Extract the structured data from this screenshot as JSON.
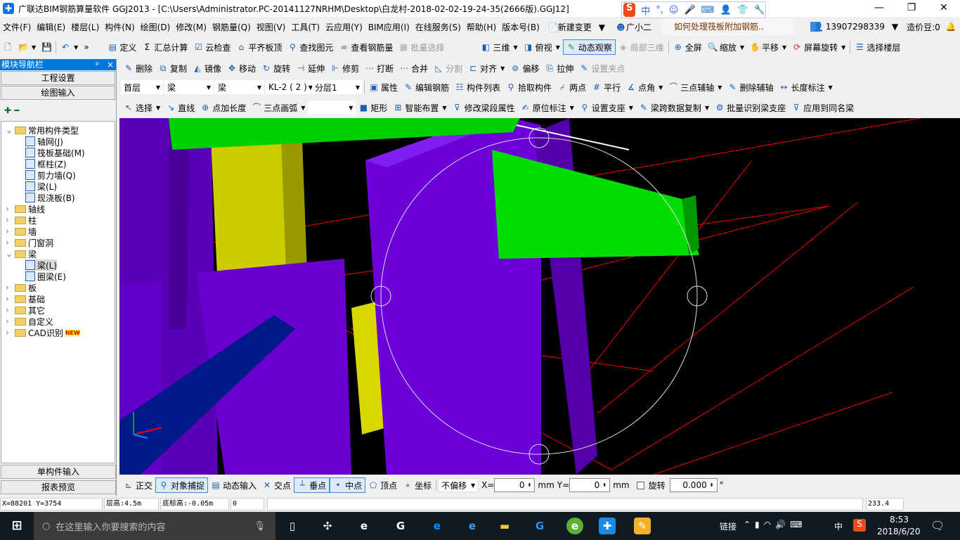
{
  "title": {
    "text": "广联达BIM钢筋算量软件 GGJ2013 - [C:\\Users\\Administrator.PC-20141127NRHM\\Desktop\\白龙村-2018-02-02-19-24-35(2666版).GGJ12]",
    "minimize": "—",
    "restore": "❐",
    "close": "✕"
  },
  "ime": {
    "logo": "S",
    "items": [
      "中",
      "°,",
      "☺",
      "🎤",
      "⌨",
      "👤",
      "👕",
      "🔧"
    ]
  },
  "menu": [
    "文件(F)",
    "编辑(E)",
    "楼层(L)",
    "构件(N)",
    "绘图(D)",
    "修改(M)",
    "钢筋量(Q)",
    "视图(V)",
    "工具(T)",
    "云应用(Y)",
    "BIM应用(I)",
    "在线服务(S)",
    "帮助(H)",
    "版本号(B)",
    "新建变更",
    "广小二",
    "如何处理筏板附加钢筋..",
    "13907298339",
    "造价豆:0"
  ],
  "toolbar1": {
    "left": [
      "定义",
      "汇总计算",
      "云检查",
      "平齐板顶",
      "查找图元",
      "查看钢筋量",
      "批量选择"
    ],
    "right": [
      "三维",
      "俯视",
      "动态观察",
      "局部三维",
      "全屏",
      "缩放",
      "平移",
      "屏幕旋转",
      "选择楼层"
    ]
  },
  "toolbar2": [
    "删除",
    "复制",
    "镜像",
    "移动",
    "旋转",
    "延伸",
    "修剪",
    "打断",
    "合并",
    "分割",
    "对齐",
    "偏移",
    "拉伸",
    "设置夹点"
  ],
  "selectors": {
    "floor": "首层",
    "type": "梁",
    "subtype": "梁",
    "component": "KL-2 ( 2 )",
    "layer": "分层1"
  },
  "toolbar3": [
    "属性",
    "编辑钢筋",
    "构件列表",
    "拾取构件",
    "两点",
    "平行",
    "点角",
    "三点辅轴",
    "删除辅轴",
    "长度标注"
  ],
  "toolbar4": [
    "选择",
    "直线",
    "点加长度",
    "三点画弧",
    "",
    "矩形",
    "智能布置",
    "修改梁段属性",
    "原位标注",
    "设置支座",
    "梁跨数据复制",
    "批量识别梁支座",
    "应用到同名梁"
  ],
  "nav": {
    "header": "模块导航栏",
    "pin": "ᵖ",
    "close": "×",
    "project_settings": "工程设置",
    "drawing_input": "绘图输入",
    "single_input": "单构件输入",
    "report_preview": "报表预览",
    "tree": [
      {
        "label": "常用构件类型",
        "level": 0,
        "expanded": true
      },
      {
        "label": "轴网(J)",
        "level": 1
      },
      {
        "label": "筏板基础(M)",
        "level": 1
      },
      {
        "label": "框柱(Z)",
        "level": 1
      },
      {
        "label": "剪力墙(Q)",
        "level": 1
      },
      {
        "label": "梁(L)",
        "level": 1
      },
      {
        "label": "现浇板(B)",
        "level": 1
      },
      {
        "label": "轴线",
        "level": 0
      },
      {
        "label": "柱",
        "level": 0
      },
      {
        "label": "墙",
        "level": 0
      },
      {
        "label": "门窗洞",
        "level": 0
      },
      {
        "label": "梁",
        "level": 0,
        "expanded": true
      },
      {
        "label": "梁(L)",
        "level": 1,
        "selected": true
      },
      {
        "label": "圈梁(E)",
        "level": 1
      },
      {
        "label": "板",
        "level": 0
      },
      {
        "label": "基础",
        "level": 0
      },
      {
        "label": "其它",
        "level": 0
      },
      {
        "label": "自定义",
        "level": 0
      },
      {
        "label": "CAD识别",
        "level": 0,
        "badge": "NEW"
      }
    ]
  },
  "bottom_toolbar": {
    "items": [
      "正交",
      "对象捕捉",
      "动态输入",
      "交点",
      "垂点",
      "中点",
      "顶点",
      "坐标"
    ],
    "offset": "不偏移",
    "x_label": "X=",
    "x_value": "0",
    "y_label": "Y=",
    "y_value": "0",
    "unit": "mm",
    "rotate": "旋转",
    "rotate_value": "0.000",
    "deg": "°"
  },
  "status": {
    "coords": "X=88201 Y=3754",
    "floor_height": "层高:4.5m",
    "base_elev": "底标高:-0.05m",
    "value": "0",
    "fps": "233.4 FPS"
  },
  "taskbar": {
    "search_placeholder": "在这里输入你要搜索的内容",
    "tray_link": "链接",
    "ime": "中",
    "time": "8:53",
    "date": "2018/6/20"
  }
}
